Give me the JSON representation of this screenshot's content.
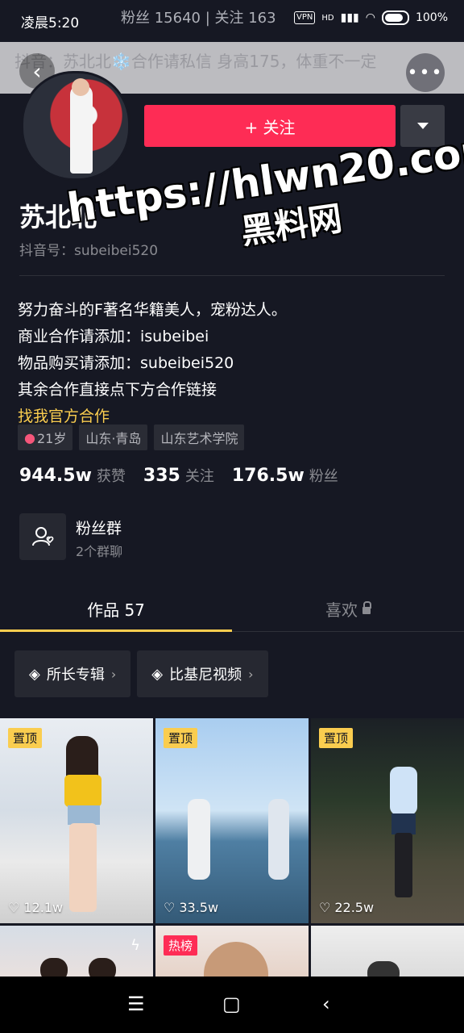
{
  "status": {
    "time": "凌晨5:20",
    "behind_text": "粉丝 15640 | 关注 163",
    "vpn": "VPN",
    "network": "HD",
    "battery": "100%"
  },
  "header": {
    "signature_preview": "抖音：苏北北❄️合作请私信 身高175，体重不一定",
    "back_icon": "back-arrow-icon",
    "more_icon": "more-dots-icon"
  },
  "profile": {
    "follow_label": "+ 关注",
    "name": "苏北北",
    "douyin_id": "抖音号：subeibei520"
  },
  "watermark": {
    "line1": "https://hlwn20.com",
    "line2": "黑料网"
  },
  "bio": {
    "lines": [
      "努力奋斗的F著名华籍美人，宠粉达人。",
      "商业合作请添加：isubeibei",
      "物品购买请添加：subeibei520",
      "其余合作直接点下方合作链接"
    ],
    "link": "找我官方合作"
  },
  "tags": {
    "age": "21岁",
    "location": "山东·青岛",
    "school": "山东艺术学院"
  },
  "stats": {
    "likes_value": "944.5w",
    "likes_label": "获赞",
    "following_value": "335",
    "following_label": "关注",
    "followers_value": "176.5w",
    "followers_label": "粉丝"
  },
  "fan_group": {
    "title": "粉丝群",
    "subtitle": "2个群聊"
  },
  "tabs": {
    "works": "作品 57",
    "likes": "喜欢"
  },
  "collections": [
    {
      "label": "所长专辑"
    },
    {
      "label": "比基尼视频"
    }
  ],
  "videos": [
    {
      "badge": "置顶",
      "likes": "12.1w"
    },
    {
      "badge": "置顶",
      "likes": "33.5w"
    },
    {
      "badge": "置顶",
      "likes": "22.5w"
    },
    {
      "badge": "",
      "likes": ""
    },
    {
      "badge": "热榜",
      "likes": ""
    },
    {
      "badge": "",
      "likes": ""
    }
  ],
  "colors": {
    "accent": "#fe2c55",
    "highlight": "#facd4f",
    "background": "#161823"
  }
}
